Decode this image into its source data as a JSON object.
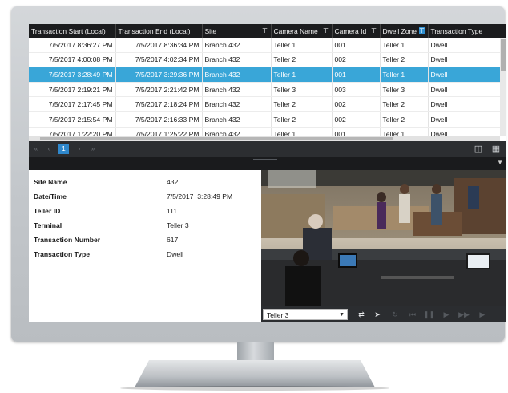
{
  "table": {
    "columns": [
      {
        "label": "Transaction Start (Local)",
        "filter": false
      },
      {
        "label": "Transaction End (Local)",
        "filter": false
      },
      {
        "label": "Site",
        "filter": true,
        "filter_active": false
      },
      {
        "label": "Camera Name",
        "filter": true,
        "filter_active": false
      },
      {
        "label": "Camera Id",
        "filter": true,
        "filter_active": false
      },
      {
        "label": "Dwell Zone",
        "filter": true,
        "filter_active": true
      },
      {
        "label": "Transaction Type",
        "filter": false
      }
    ],
    "rows": [
      [
        "7/5/2017 8:36:27 PM",
        "7/5/2017 8:36:34 PM",
        "Branch 432",
        "Teller 1",
        "001",
        "Teller 1",
        "Dwell"
      ],
      [
        "7/5/2017 4:00:08 PM",
        "7/5/2017 4:02:34 PM",
        "Branch 432",
        "Teller 2",
        "002",
        "Teller 2",
        "Dwell"
      ],
      [
        "7/5/2017 3:28:49 PM",
        "7/5/2017 3:29:36 PM",
        "Branch 432",
        "Teller 1",
        "001",
        "Teller 1",
        "Dwell"
      ],
      [
        "7/5/2017 2:19:21 PM",
        "7/5/2017 2:21:42 PM",
        "Branch 432",
        "Teller 3",
        "003",
        "Teller 3",
        "Dwell"
      ],
      [
        "7/5/2017 2:17:45 PM",
        "7/5/2017 2:18:24 PM",
        "Branch 432",
        "Teller 2",
        "002",
        "Teller 2",
        "Dwell"
      ],
      [
        "7/5/2017 2:15:54 PM",
        "7/5/2017 2:16:33 PM",
        "Branch 432",
        "Teller 2",
        "002",
        "Teller 2",
        "Dwell"
      ],
      [
        "7/5/2017 1:22:20 PM",
        "7/5/2017 1:25:22 PM",
        "Branch 432",
        "Teller 1",
        "001",
        "Teller 1",
        "Dwell"
      ]
    ],
    "selected_row": 2
  },
  "pager": {
    "first": "«",
    "prev": "‹",
    "current_page": "1",
    "next": "›",
    "last": "»",
    "tools": [
      "export-icon",
      "columns-icon"
    ]
  },
  "details": {
    "fields": [
      {
        "label": "Site Name",
        "value": "432"
      },
      {
        "label": "Date/Time",
        "value": "7/5/2017  3:28:49 PM"
      },
      {
        "label": "Teller ID",
        "value": "111"
      },
      {
        "label": "Terminal",
        "value": "Teller 3"
      },
      {
        "label": "Transaction Number",
        "value": "617"
      },
      {
        "label": "Transaction Type",
        "value": "Dwell"
      }
    ]
  },
  "video": {
    "camera_selected": "Teller 3",
    "controls": [
      "snapshot-icon",
      "export-clip-icon",
      "sync-icon",
      "skip-back-icon",
      "pause-icon",
      "play-icon",
      "fast-forward-icon",
      "skip-end-icon"
    ]
  },
  "colors": {
    "selection": "#39a6d8",
    "header_bg": "#1b1c1e",
    "accent": "#2f88cc"
  }
}
